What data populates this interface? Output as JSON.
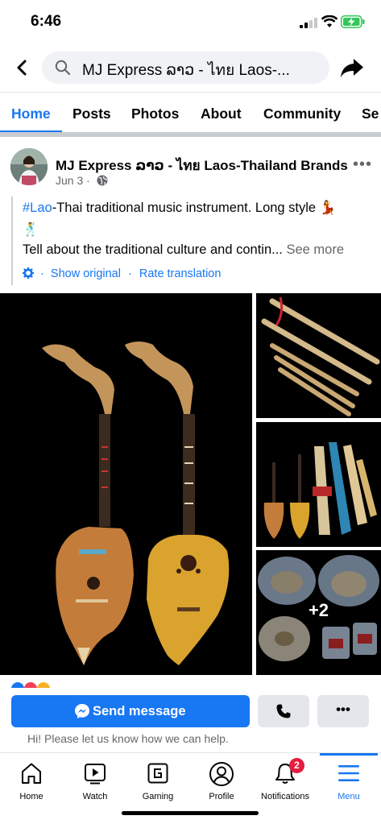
{
  "status_bar": {
    "time": "6:46",
    "signal_icon": "cellular-signal-icon",
    "wifi_icon": "wifi-icon",
    "battery_icon": "battery-charging-icon"
  },
  "header": {
    "back_icon": "back-arrow-icon",
    "search_icon": "search-icon",
    "search_text": "MJ Express  ລາວ - ไทย Laos-...",
    "share_icon": "share-arrow-icon"
  },
  "tabs": [
    {
      "label": "Home",
      "active": true
    },
    {
      "label": "Posts"
    },
    {
      "label": "Photos"
    },
    {
      "label": "About"
    },
    {
      "label": "Community"
    },
    {
      "label": "Se"
    }
  ],
  "post": {
    "author": "MJ Express  ລາວ - ไทย Laos-Thailand Brands",
    "date": "Jun 3",
    "date_separator": "·",
    "privacy_icon": "globe-icon",
    "more_label": "•••",
    "text_hashtag": "#Lao",
    "text_line1": "-Thai traditional music instrument. Long style",
    "dancer_emoji": "💃",
    "dancer_emoji_2": "🕺",
    "text_line2": "Tell about the traditional culture and contin...",
    "see_more": "See more",
    "show_original": "Show original",
    "rate_translation": "Rate translation",
    "translate_separator": "·",
    "photos_more_count": "+2"
  },
  "actions": {
    "send_message_label": "Send message",
    "messenger_icon": "messenger-icon",
    "call_icon": "phone-icon",
    "more_label": "•••",
    "help_text": "Hi! Please let us know how we can help."
  },
  "bottom_nav": [
    {
      "label": "Home",
      "icon": "home-icon"
    },
    {
      "label": "Watch",
      "icon": "watch-video-icon"
    },
    {
      "label": "Gaming",
      "icon": "gaming-icon"
    },
    {
      "label": "Profile",
      "icon": "profile-icon"
    },
    {
      "label": "Notifications",
      "icon": "bell-icon",
      "badge": "2"
    },
    {
      "label": "Menu",
      "icon": "hamburger-menu-icon",
      "active": true
    }
  ],
  "colors": {
    "accent": "#1877f2",
    "badge": "#e41e3f",
    "secondary_text": "#65676b"
  }
}
